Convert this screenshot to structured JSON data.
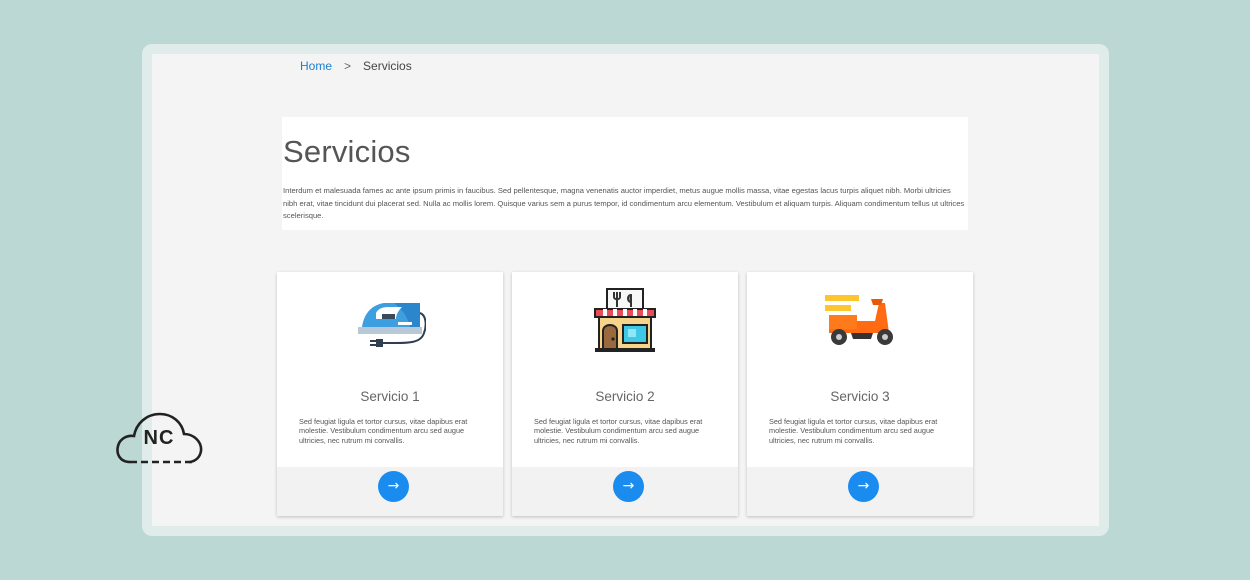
{
  "breadcrumb": {
    "home": "Home",
    "separator": ">",
    "current": "Servicios"
  },
  "intro": {
    "title": "Servicios",
    "text": "Interdum et malesuada fames ac ante ipsum primis in faucibus. Sed pellentesque, magna venenatis auctor imperdiet, metus augue mollis massa, vitae egestas lacus turpis aliquet nibh. Morbi ultricies nibh erat, vitae tincidunt dui placerat sed. Nulla ac mollis lorem. Quisque varius sem a purus tempor, id condimentum arcu elementum. Vestibulum et aliquam turpis. Aliquam condimentum tellus ut ultrices scelerisque."
  },
  "services": [
    {
      "title": "Servicio 1",
      "text": "Sed feugiat ligula et tortor cursus, vitae dapibus erat molestie. Vestibulum condimentum arcu sed augue ultricies, nec rutrum mi convallis.",
      "icon": "iron-icon",
      "button": "→"
    },
    {
      "title": "Servicio 2",
      "text": "Sed feugiat ligula et tortor cursus, vitae dapibus erat molestie. Vestibulum condimentum arcu sed augue ultricies, nec rutrum mi convallis.",
      "icon": "restaurant-store-icon",
      "button": "→"
    },
    {
      "title": "Servicio 3",
      "text": "Sed feugiat ligula et tortor cursus, vitae dapibus erat molestie. Vestibulum condimentum arcu sed augue ultricies, nec rutrum mi convallis.",
      "icon": "scooter-delivery-icon",
      "button": "→"
    }
  ],
  "logo": {
    "text": "NC",
    "icon": "cloud-logo-icon"
  },
  "colors": {
    "accent": "#1a8cf0",
    "link": "#1a7fd4",
    "background": "#bcd8d4",
    "page": "#f4f4f4"
  }
}
